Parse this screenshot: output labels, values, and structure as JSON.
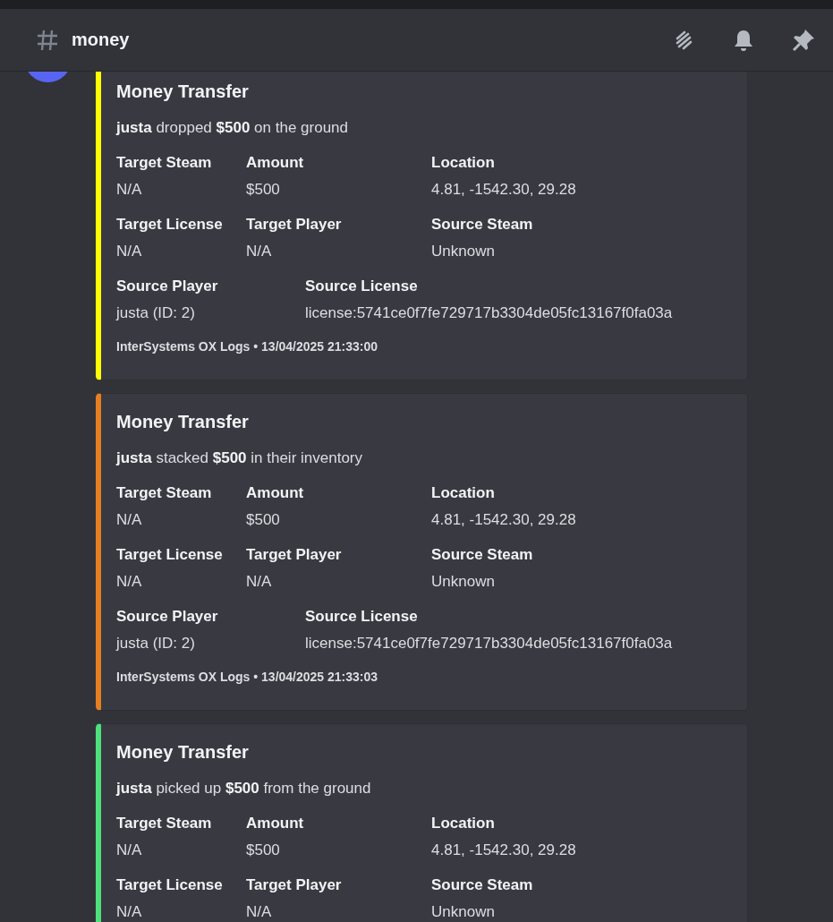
{
  "header": {
    "channel_name": "money"
  },
  "embeds": [
    {
      "color": "#ffff00",
      "title": "Money Transfer",
      "description": "**justa** dropped **$500** on the ground",
      "field_rows": [
        [
          {
            "name": "Target Steam",
            "value": "N/A"
          },
          {
            "name": "Amount",
            "value": "$500"
          },
          {
            "name": "Location",
            "value": "4.81, -1542.30, 29.28"
          }
        ],
        [
          {
            "name": "Target License",
            "value": "N/A"
          },
          {
            "name": "Target Player",
            "value": "N/A"
          },
          {
            "name": "Source Steam",
            "value": "Unknown"
          }
        ],
        [
          {
            "name": "Source Player",
            "value": "justa (ID: 2)"
          },
          {
            "name": "Source License",
            "value": "license:5741ce0f7fe729717b3304de05fc13167f0fa03a"
          }
        ]
      ],
      "footer": "InterSystems OX Logs • 13/04/2025 21:33:00"
    },
    {
      "color": "#e67e22",
      "title": "Money Transfer",
      "description": "**justa** stacked **$500** in their inventory",
      "field_rows": [
        [
          {
            "name": "Target Steam",
            "value": "N/A"
          },
          {
            "name": "Amount",
            "value": "$500"
          },
          {
            "name": "Location",
            "value": "4.81, -1542.30, 29.28"
          }
        ],
        [
          {
            "name": "Target License",
            "value": "N/A"
          },
          {
            "name": "Target Player",
            "value": "N/A"
          },
          {
            "name": "Source Steam",
            "value": "Unknown"
          }
        ],
        [
          {
            "name": "Source Player",
            "value": "justa (ID: 2)"
          },
          {
            "name": "Source License",
            "value": "license:5741ce0f7fe729717b3304de05fc13167f0fa03a"
          }
        ]
      ],
      "footer": "InterSystems OX Logs • 13/04/2025 21:33:03"
    },
    {
      "color": "#4ee07a",
      "title": "Money Transfer",
      "description": "**justa** picked up **$500** from the ground",
      "field_rows": [
        [
          {
            "name": "Target Steam",
            "value": "N/A"
          },
          {
            "name": "Amount",
            "value": "$500"
          },
          {
            "name": "Location",
            "value": "4.81, -1542.30, 29.28"
          }
        ],
        [
          {
            "name": "Target License",
            "value": "N/A"
          },
          {
            "name": "Target Player",
            "value": "N/A"
          },
          {
            "name": "Source Steam",
            "value": "Unknown"
          }
        ]
      ]
    }
  ]
}
